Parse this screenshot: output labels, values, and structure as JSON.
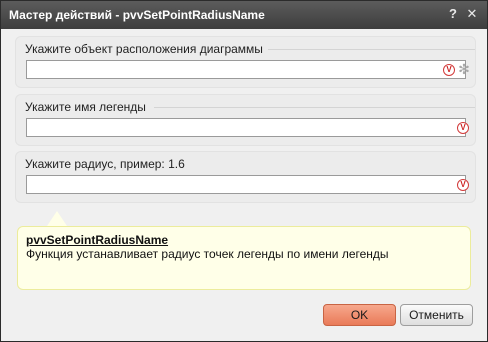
{
  "window": {
    "title": "Мастер действий - pvvSetPointRadiusName",
    "help_glyph": "?",
    "close_glyph": "✕"
  },
  "fields": [
    {
      "label": "Укажите объект расположения диаграммы",
      "value": "",
      "has_picker": true
    },
    {
      "label": "Укажите имя легенды",
      "value": "",
      "has_picker": false
    },
    {
      "label": "Укажите радиус, пример: 1.6",
      "value": "",
      "has_picker": false
    }
  ],
  "validation_icon": {
    "glyph": "V",
    "color": "#cc1f1f"
  },
  "picker_icon": {
    "glyph": "✻"
  },
  "info": {
    "function_name": "pvvSetPointRadiusName",
    "description": "Функция устанавливает радиус точек легенды по имени легенды"
  },
  "buttons": {
    "ok": "OK",
    "cancel": "Отменить"
  },
  "colors": {
    "titlebar": "#4a4a4a",
    "ok_button": "#ef8c6c",
    "info_background": "#ffffe8"
  }
}
